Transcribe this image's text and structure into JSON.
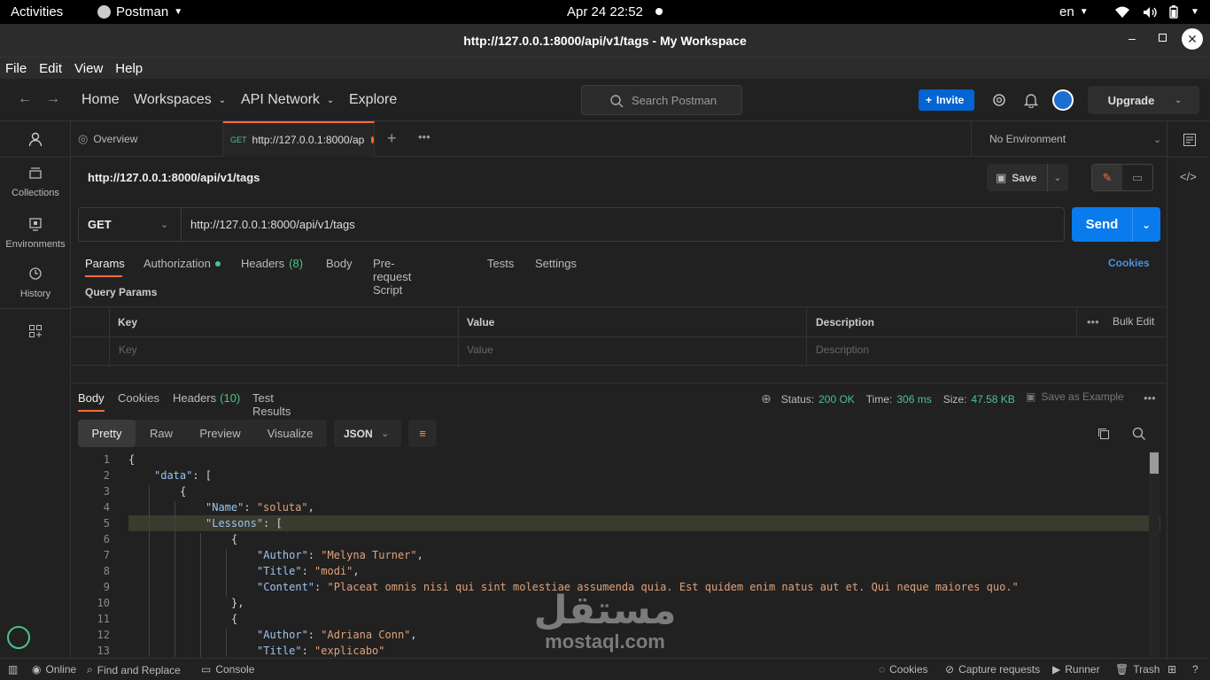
{
  "system": {
    "activities": "Activities",
    "app_name": "Postman",
    "clock": "Apr 24  22:52",
    "lang": "en"
  },
  "window": {
    "title": "http://127.0.0.1:8000/api/v1/tags - My Workspace"
  },
  "menu": [
    "File",
    "Edit",
    "View",
    "Help"
  ],
  "header": {
    "home": "Home",
    "workspaces": "Workspaces",
    "api_network": "API Network",
    "explore": "Explore",
    "search_placeholder": "Search Postman",
    "invite": "Invite",
    "upgrade": "Upgrade"
  },
  "sidebar": {
    "items": [
      {
        "label": "Collections",
        "icon": "collections-icon"
      },
      {
        "label": "Environments",
        "icon": "environments-icon"
      },
      {
        "label": "History",
        "icon": "history-icon"
      }
    ]
  },
  "tabs": {
    "overview": "Overview",
    "active_method": "GET",
    "active_url": "http://127.0.0.1:8000/ap",
    "environment": "No Environment"
  },
  "request": {
    "name": "http://127.0.0.1:8000/api/v1/tags",
    "save": "Save",
    "method": "GET",
    "url": "http://127.0.0.1:8000/api/v1/tags",
    "send": "Send",
    "subtabs": {
      "params": "Params",
      "authorization": "Authorization",
      "headers": "Headers",
      "headers_count": "(8)",
      "body": "Body",
      "prerequest": "Pre-request Script",
      "tests": "Tests",
      "settings": "Settings",
      "cookies": "Cookies"
    },
    "query_params_title": "Query Params",
    "table": {
      "headers": [
        "Key",
        "Value",
        "Description"
      ],
      "placeholders": [
        "Key",
        "Value",
        "Description"
      ],
      "bulk_edit": "Bulk Edit"
    }
  },
  "response": {
    "tabs": {
      "body": "Body",
      "cookies": "Cookies",
      "headers": "Headers",
      "headers_count": "(10)",
      "test_results": "Test Results"
    },
    "status_label": "Status:",
    "status_value": "200 OK",
    "time_label": "Time:",
    "time_value": "306 ms",
    "size_label": "Size:",
    "size_value": "47.58 KB",
    "save_as_example": "Save as Example",
    "views": [
      "Pretty",
      "Raw",
      "Preview",
      "Visualize"
    ],
    "format": "JSON",
    "lines": [
      {
        "n": "1",
        "indent": 0,
        "parts": [
          [
            "p",
            "{"
          ]
        ]
      },
      {
        "n": "2",
        "indent": 1,
        "parts": [
          [
            "k",
            "\"data\""
          ],
          [
            "p",
            ": ["
          ]
        ]
      },
      {
        "n": "3",
        "indent": 2,
        "parts": [
          [
            "p",
            "{"
          ]
        ]
      },
      {
        "n": "4",
        "indent": 3,
        "parts": [
          [
            "k",
            "\"Name\""
          ],
          [
            "p",
            ": "
          ],
          [
            "s",
            "\"soluta\""
          ],
          [
            "p",
            ","
          ]
        ]
      },
      {
        "n": "5",
        "indent": 3,
        "parts": [
          [
            "k",
            "\"Lessons\""
          ],
          [
            "p",
            ": ["
          ]
        ]
      },
      {
        "n": "6",
        "indent": 4,
        "parts": [
          [
            "p",
            "{"
          ]
        ]
      },
      {
        "n": "7",
        "indent": 5,
        "parts": [
          [
            "k",
            "\"Author\""
          ],
          [
            "p",
            ": "
          ],
          [
            "s",
            "\"Melyna Turner\""
          ],
          [
            "p",
            ","
          ]
        ]
      },
      {
        "n": "8",
        "indent": 5,
        "parts": [
          [
            "k",
            "\"Title\""
          ],
          [
            "p",
            ": "
          ],
          [
            "s",
            "\"modi\""
          ],
          [
            "p",
            ","
          ]
        ]
      },
      {
        "n": "9",
        "indent": 5,
        "parts": [
          [
            "k",
            "\"Content\""
          ],
          [
            "p",
            ": "
          ],
          [
            "s",
            "\"Placeat omnis nisi qui sint molestiae assumenda quia. Est quidem enim natus aut et. Qui neque maiores quo.\""
          ]
        ]
      },
      {
        "n": "10",
        "indent": 4,
        "parts": [
          [
            "p",
            "},"
          ]
        ]
      },
      {
        "n": "11",
        "indent": 4,
        "parts": [
          [
            "p",
            "{"
          ]
        ]
      },
      {
        "n": "12",
        "indent": 5,
        "parts": [
          [
            "k",
            "\"Author\""
          ],
          [
            "p",
            ": "
          ],
          [
            "s",
            "\"Adriana Conn\""
          ],
          [
            "p",
            ","
          ]
        ]
      },
      {
        "n": "13",
        "indent": 5,
        "parts": [
          [
            "k",
            "\"Title\""
          ],
          [
            "p",
            ": "
          ],
          [
            "s",
            "\"explicabo\""
          ]
        ]
      }
    ]
  },
  "statusbar": {
    "online": "Online",
    "find_replace": "Find and Replace",
    "console": "Console",
    "cookies": "Cookies",
    "capture": "Capture requests",
    "runner": "Runner",
    "trash": "Trash"
  },
  "watermark": {
    "arabic": "مستقل",
    "latin": "mostaql.com"
  },
  "colors": {
    "accent_orange": "#ff6c37",
    "send_blue": "#097bed",
    "status_green": "#4cc38a",
    "invite_blue": "#0265d2"
  }
}
